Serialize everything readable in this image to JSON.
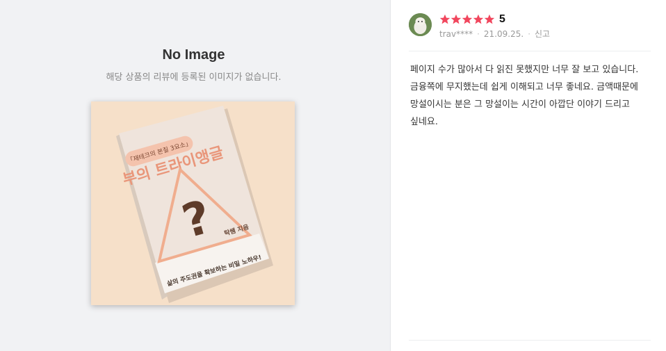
{
  "no_image": {
    "title": "No Image",
    "description": "해당 상품의 리뷰에 등록된 이미지가 없습니다."
  },
  "product_image": {
    "book_subtitle": "「재테크의 본질 3요소」",
    "book_title": "부의 트라이앵글",
    "book_author": "탁쌤 지음",
    "book_tagline": "삶의 주도권을 확보하는 비밀 노하우!",
    "colors": {
      "background": "#f6e0c9",
      "cover": "#efe4dc",
      "title": "#e9967a",
      "question_mark": "#5e3b29",
      "band": "#f7f3ef"
    }
  },
  "review": {
    "rating_stars": 5,
    "rating_value": "5",
    "star_color": "#f1465d",
    "user": "trav****",
    "date": "21.09.25.",
    "report_label": "신고",
    "text": "페이지 수가 많아서 다 읽진 못했지만 너무 잘 보고 있습니다. 금융쪽에 무지했는데 쉽게 이해되고 너무 좋네요. 금액때문에 망설이시는 분은 그 망설이는 시간이 아깝단 이야기 드리고 싶네요."
  }
}
